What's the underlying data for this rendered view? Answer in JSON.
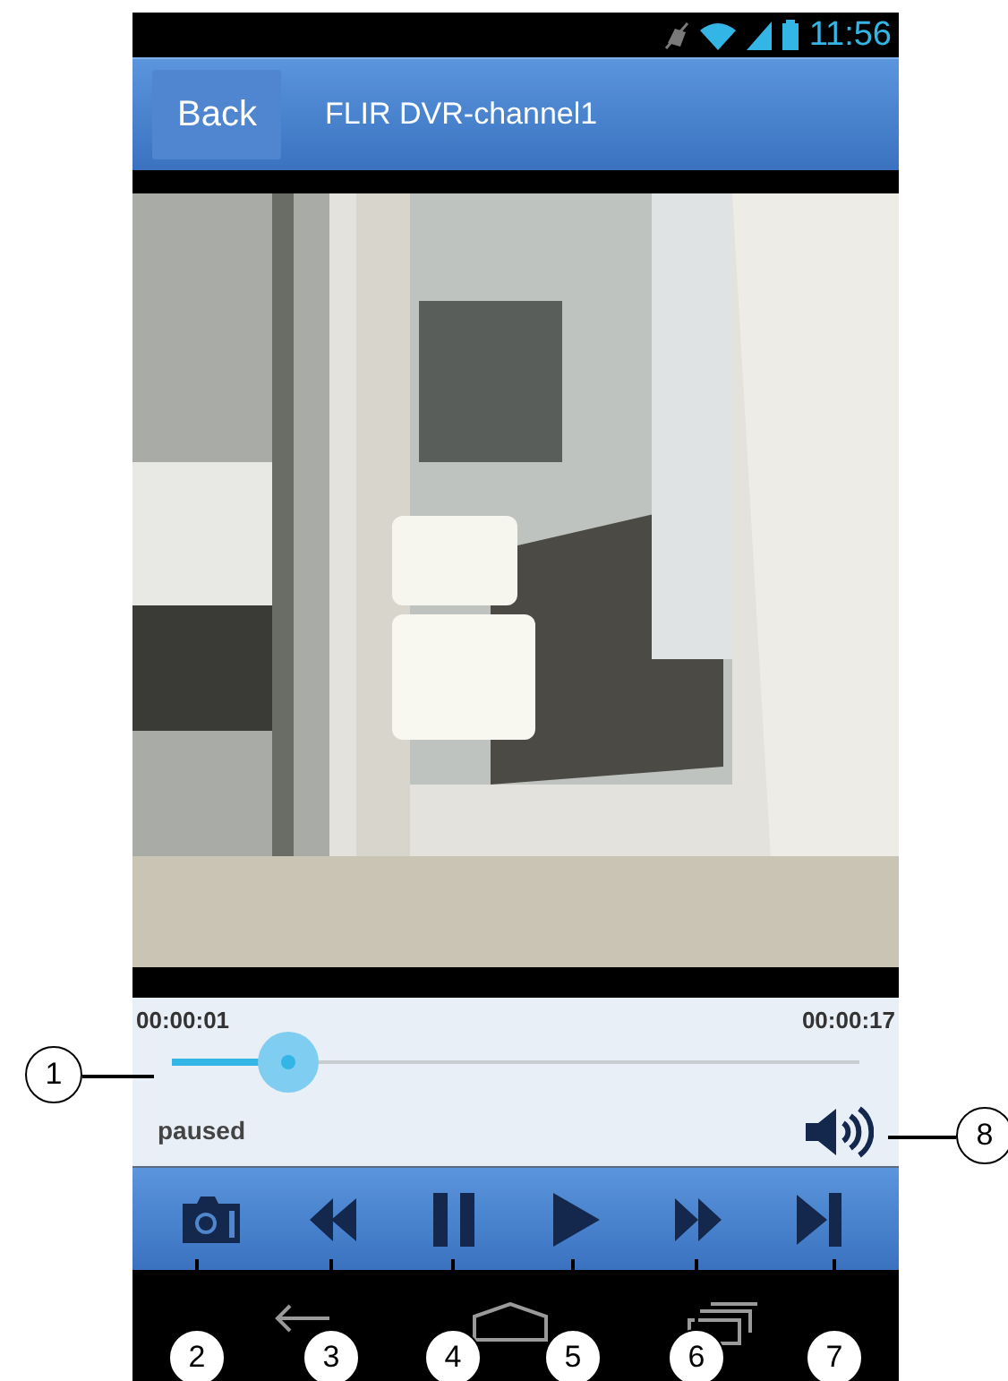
{
  "status_bar": {
    "time": "11:56"
  },
  "header": {
    "back_button": "Back",
    "title": "FLIR DVR-channel1"
  },
  "playback": {
    "elapsed": "00:00:01",
    "duration": "00:00:17",
    "level": 0.17,
    "status": "paused"
  },
  "controls": [
    {
      "kind": "snapshot"
    },
    {
      "kind": "rewind"
    },
    {
      "kind": "pause"
    },
    {
      "kind": "play"
    },
    {
      "kind": "fast_forward"
    },
    {
      "kind": "skip_end"
    }
  ],
  "callouts": [
    {
      "label": "1"
    },
    {
      "label": "2"
    },
    {
      "label": "3"
    },
    {
      "label": "4"
    },
    {
      "label": "5"
    },
    {
      "label": "6"
    },
    {
      "label": "7"
    },
    {
      "label": "8"
    }
  ]
}
